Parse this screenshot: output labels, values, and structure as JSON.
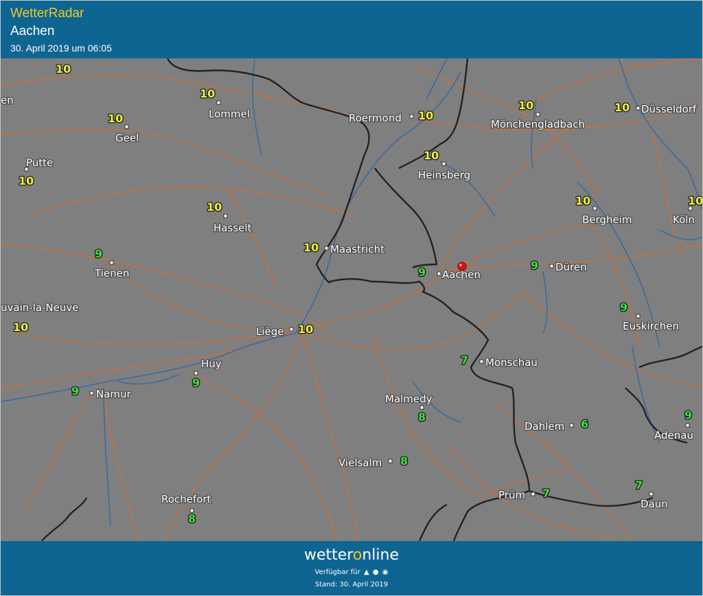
{
  "header": {
    "app_title": "WetterRadar",
    "location": "Aachen",
    "datetime": "30. April 2019 um 06:05"
  },
  "footer": {
    "brand_prefix": "wetter",
    "brand_o": "o",
    "brand_suffix": "nline",
    "availability_label": "Verfügbar für",
    "platform_icons": [
      "android-icon",
      "apple-icon",
      "web-icon"
    ],
    "stand": "Stand: 30. April 2019"
  },
  "colors": {
    "header_bg": "#0e6591",
    "title_yellow": "#f3c625",
    "map_bg": "#7f7f7f",
    "roads": "#c8703a",
    "rivers": "#3c6a9c",
    "borders": "#222222",
    "temp_10": "#f0f03c",
    "temp_9_and_below": "#3ee03e",
    "pin": "#e01010"
  },
  "map": {
    "selected_place": "Aachen",
    "cities": [
      {
        "name": "Lommel"
      },
      {
        "name": "Geel"
      },
      {
        "name": "Putte"
      },
      {
        "name": "Hasselt"
      },
      {
        "name": "Tienen"
      },
      {
        "name": "uvain-la-Neuve"
      },
      {
        "name": "Liège"
      },
      {
        "name": "Huy"
      },
      {
        "name": "Namur"
      },
      {
        "name": "Rochefort"
      },
      {
        "name": "Roermond"
      },
      {
        "name": "Mönchengladbach"
      },
      {
        "name": "Düsseldorf"
      },
      {
        "name": "Heinsberg"
      },
      {
        "name": "Maastricht"
      },
      {
        "name": "Aachen"
      },
      {
        "name": "Düren"
      },
      {
        "name": "Bergheim"
      },
      {
        "name": "Köln"
      },
      {
        "name": "Euskirchen"
      },
      {
        "name": "Monschau"
      },
      {
        "name": "Malmedy"
      },
      {
        "name": "Vielsalm"
      },
      {
        "name": "Dahlem"
      },
      {
        "name": "Adenau"
      },
      {
        "name": "Prüm"
      },
      {
        "name": "Daun"
      },
      {
        "name": "en"
      }
    ],
    "temperatures": [
      {
        "value": "10"
      },
      {
        "value": "10"
      },
      {
        "value": "10"
      },
      {
        "value": "10"
      },
      {
        "value": "10"
      },
      {
        "value": "10"
      },
      {
        "value": "10"
      },
      {
        "value": "10"
      },
      {
        "value": "10"
      },
      {
        "value": "10"
      },
      {
        "value": "10"
      },
      {
        "value": "10"
      },
      {
        "value": "10"
      },
      {
        "value": "10"
      },
      {
        "value": "9"
      },
      {
        "value": "9"
      },
      {
        "value": "9"
      },
      {
        "value": "9"
      },
      {
        "value": "9"
      },
      {
        "value": "9"
      },
      {
        "value": "7"
      },
      {
        "value": "8"
      },
      {
        "value": "8"
      },
      {
        "value": "6"
      },
      {
        "value": "9"
      },
      {
        "value": "7"
      },
      {
        "value": "7"
      },
      {
        "value": "8"
      }
    ]
  }
}
